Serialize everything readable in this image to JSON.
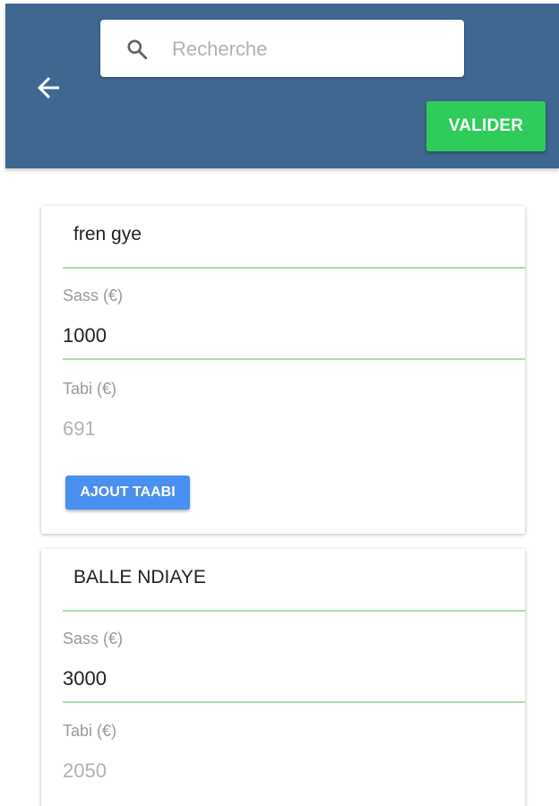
{
  "header": {
    "search": {
      "placeholder": "Recherche",
      "value": ""
    },
    "back_icon": "arrow-left-icon",
    "search_icon": "search-icon",
    "valider_label": "VALIDER"
  },
  "colors": {
    "app_bar": "#3f6790",
    "valider": "#2ecc5a",
    "ajout": "#4a90f0",
    "field_underline": "#a7e0b2"
  },
  "cards": [
    {
      "name": "fren gye",
      "sass_label": "Sass (€)",
      "sass_value": "1000",
      "tabi_label": "Tabi (€)",
      "tabi_value": "691",
      "ajout_label": "AJOUT TAABI"
    },
    {
      "name": "BALLE NDIAYE",
      "sass_label": "Sass (€)",
      "sass_value": "3000",
      "tabi_label": "Tabi (€)",
      "tabi_value": "2050"
    }
  ]
}
